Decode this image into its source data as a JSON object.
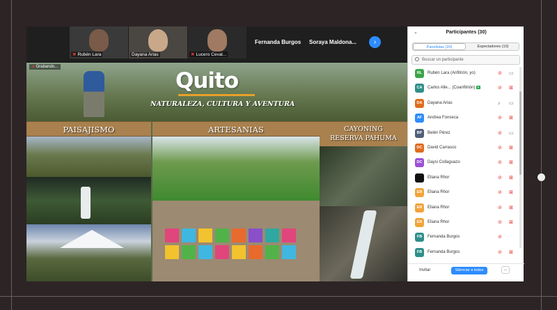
{
  "strip": {
    "thumbs": [
      {
        "name": "Rubén Lara"
      },
      {
        "name": "Dayana Arias"
      },
      {
        "name": "Lucero Ceval..."
      }
    ],
    "text_tiles": [
      "Fernanda Burgos",
      "Soraya  Maldona..."
    ]
  },
  "slide": {
    "recording": "Grabando...",
    "logo": "Quito",
    "tagline": "NATURALEZA, CULTURA Y AVENTURA",
    "sections": [
      "PAISAJISMO",
      "ARTESANIAS"
    ],
    "section3_line1": "CAYONING",
    "section3_line2": "RESERVA PAHUMA"
  },
  "panel": {
    "title": "Participantes (30)",
    "tab_panelists": "Panelistas (20)",
    "tab_attendees": "Espectadores (10)",
    "search_placeholder": "Buscar un participante",
    "participants": [
      {
        "initials": "RL",
        "name": "Rubén Lara (Anfitrión, yo)",
        "color": "#3aa54a",
        "mic": "off",
        "cam": "on",
        "tag": ""
      },
      {
        "initials": "CA",
        "name": "Carlos Alle... (Coanfitrión)",
        "color": "#2e8f8a",
        "mic": "off",
        "cam": "off",
        "tag": "R"
      },
      {
        "initials": "DA",
        "name": "Dayana Arias",
        "color": "#e06c1f",
        "mic": "on",
        "cam": "on",
        "tag": ""
      },
      {
        "initials": "AF",
        "name": "Andrea Fonseca",
        "color": "#2d8cff",
        "mic": "off",
        "cam": "off",
        "tag": ""
      },
      {
        "initials": "BP",
        "name": "Belén Pérez",
        "color": "#4f5f7a",
        "mic": "off",
        "cam": "on",
        "tag": ""
      },
      {
        "initials": "DC",
        "name": "David Carrasco",
        "color": "#e06c1f",
        "mic": "off",
        "cam": "off",
        "tag": ""
      },
      {
        "initials": "DC",
        "name": "Daysi Collaguazo",
        "color": "#9c4fd6",
        "mic": "off",
        "cam": "off",
        "tag": ""
      },
      {
        "initials": "",
        "name": "Eliana Rhor",
        "color": "#111111",
        "mic": "off",
        "cam": "off",
        "tag": ""
      },
      {
        "initials": "ER",
        "name": "Eliana Rhor",
        "color": "#f2a33a",
        "mic": "off",
        "cam": "off",
        "tag": ""
      },
      {
        "initials": "ER",
        "name": "Eliana Rhor",
        "color": "#f2a33a",
        "mic": "off",
        "cam": "off",
        "tag": ""
      },
      {
        "initials": "ER",
        "name": "Eliana Rhor",
        "color": "#f2a33a",
        "mic": "off",
        "cam": "off",
        "tag": ""
      },
      {
        "initials": "FB",
        "name": "Fernanda Burgos",
        "color": "#2e8f8a",
        "mic": "off",
        "cam": "none",
        "tag": ""
      },
      {
        "initials": "FB",
        "name": "Fernanda Burgos",
        "color": "#2e8f8a",
        "mic": "off",
        "cam": "off",
        "tag": ""
      }
    ],
    "invite_label": "Invitar",
    "mute_all_label": "Silenciar a todos",
    "more_label": "..."
  },
  "colors": {
    "accent": "#2d8cff",
    "muted_red": "#e53935",
    "wood_band": "#a9814e"
  }
}
